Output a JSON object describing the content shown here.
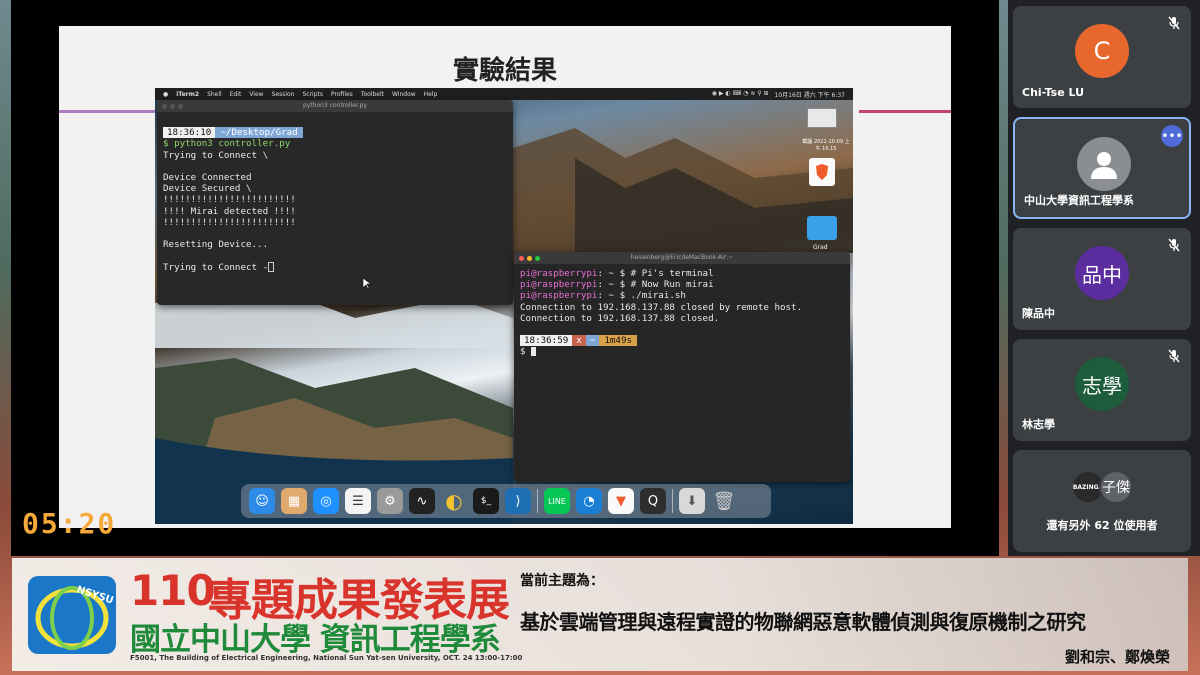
{
  "timer": "05:20",
  "slide": {
    "title": "實驗結果"
  },
  "mac": {
    "menubar": {
      "items": [
        "iTerm2",
        "Shell",
        "Edit",
        "View",
        "Session",
        "Scripts",
        "Profiles",
        "Toolbelt",
        "Window",
        "Help"
      ],
      "clock": "10月16日 週六 下午 6:37"
    },
    "desktop": {
      "date_label": "截圖 2021-10-09 上午 10.15",
      "folder_label": "Grad"
    },
    "term1": {
      "title": "python3 controller.py",
      "prompt_time": "18:36:10",
      "prompt_path": "~/Desktop/Grad",
      "lines": [
        "$ python3 controller.py",
        "Trying to Connect \\",
        "",
        "Device Connected",
        "Device Secured \\",
        "!!!!!!!!!!!!!!!!!!!!!!!!",
        "!!!! Mirai detected !!!!",
        "!!!!!!!!!!!!!!!!!!!!!!!!",
        "",
        "Resetting Device...",
        "",
        "Trying to Connect -"
      ]
    },
    "term2": {
      "title": "heisenberg@EricdeMacBook-Air:~",
      "user_host": "pi@raspberrypi",
      "cmds": [
        ": ~ $ # Pi's terminal",
        ": ~ $ # Now Run mirai",
        ": ~ $ ./mirai.sh"
      ],
      "out": [
        "Connection to 192.168.137.88 closed by remote host.",
        "Connection to 192.168.137.88 closed."
      ],
      "prompt_time": "18:36:59",
      "prompt_x": "x",
      "prompt_tilde": "~",
      "prompt_dur": "1m49s",
      "dollar": "$"
    }
  },
  "participants": [
    {
      "name": "Chi-Tse LU",
      "initial": "C",
      "color": "#e8672c",
      "muted": true
    },
    {
      "name": "中山大學資訊工程學系",
      "initial": "",
      "color": "#8a8d91",
      "muted": false
    },
    {
      "name": "陳品中",
      "initial": "品中",
      "color": "#5b2d9e",
      "muted": true
    },
    {
      "name": "林志學",
      "initial": "志學",
      "color": "#1e5d3b",
      "muted": true
    }
  ],
  "others": {
    "avatar_a": "BAZINGA",
    "avatar_b": "子傑",
    "text": "還有另外 62 位使用者"
  },
  "banner": {
    "num": "110",
    "title": "專題成果發表展",
    "school": "國立中山大學 資訊工程學系",
    "address": "F5001, The Building of Electrical Engineering, National Sun Yat-sen University, OCT. 24 13:00-17:00",
    "topic_label": "當前主題為：",
    "topic": "基於雲端管理與遠程實證的物聯網惡意軟體偵測與復原機制之研究",
    "authors": "劉和宗、鄭煥榮",
    "logo_text": "NSYSU"
  }
}
